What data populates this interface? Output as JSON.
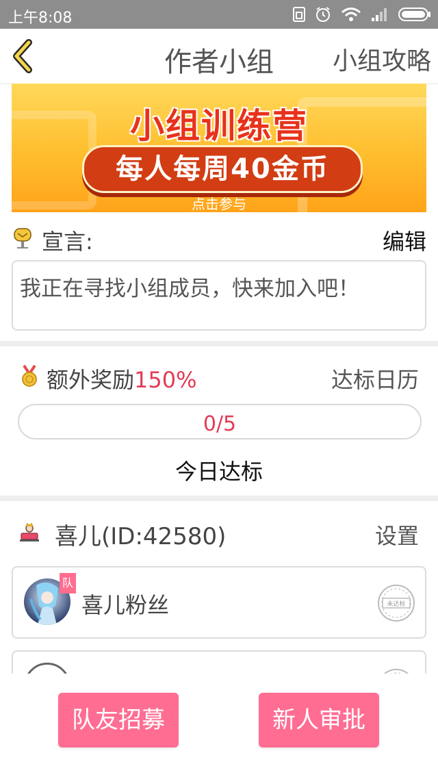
{
  "status_bar": {
    "time": "上午8:08"
  },
  "header": {
    "title": "作者小组",
    "guide_link": "小组攻略"
  },
  "banner": {
    "title": "小组训练营",
    "reward": "每人每周40金币",
    "subtitle": "点击参与"
  },
  "declaration": {
    "label": "宣言:",
    "edit_label": "编辑",
    "text": "我正在寻找小组成员，快来加入吧！"
  },
  "bonus": {
    "label": "额外奖励",
    "percent": "150%",
    "calendar_link": "达标日历",
    "progress_text": "0/5",
    "progress_fraction": 0,
    "today_label": "今日达标"
  },
  "group": {
    "leader": "喜儿(ID:42580)",
    "settings_label": "设置",
    "members": [
      {
        "name": "喜儿粉丝",
        "badge": "队",
        "stamp": "未达标"
      }
    ]
  },
  "actions": {
    "recruit": "队友招募",
    "approve": "新人审批"
  },
  "colors": {
    "accent_pink": "#ff6d92",
    "accent_red": "#e33b56"
  }
}
